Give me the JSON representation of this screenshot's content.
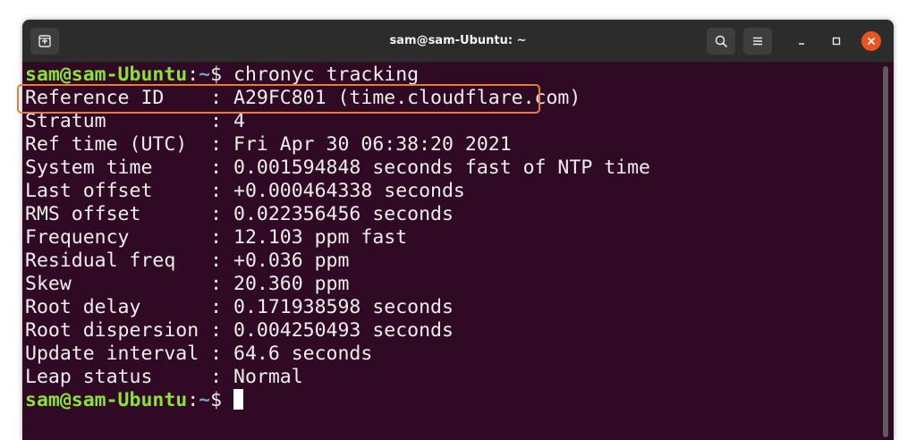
{
  "window": {
    "title": "sam@sam-Ubuntu: ~"
  },
  "icons": {
    "new_tab": "new-tab-icon",
    "search": "search-icon",
    "menu": "hamburger-menu-icon",
    "minimize": "minimize-icon",
    "maximize": "maximize-icon",
    "close": "close-icon"
  },
  "colors": {
    "terminal_bg": "#300a24",
    "prompt_user": "#8ae234",
    "prompt_path": "#729fcf",
    "highlight_border": "#e87a3a",
    "close_button": "#e95420"
  },
  "terminal": {
    "prompt": {
      "user": "sam@sam-Ubuntu",
      "colon": ":",
      "path": "~",
      "dollar": "$ "
    },
    "command": "chronyc tracking",
    "output": [
      "Reference ID    : A29FC801 (time.cloudflare.com)",
      "Stratum         : 4",
      "Ref time (UTC)  : Fri Apr 30 06:38:20 2021",
      "System time     : 0.001594848 seconds fast of NTP time",
      "Last offset     : +0.000464338 seconds",
      "RMS offset      : 0.022356456 seconds",
      "Frequency       : 12.103 ppm fast",
      "Residual freq   : +0.036 ppm",
      "Skew            : 20.360 ppm",
      "Root delay      : 0.171938598 seconds",
      "Root dispersion : 0.004250493 seconds",
      "Update interval : 64.6 seconds",
      "Leap status     : Normal"
    ]
  }
}
